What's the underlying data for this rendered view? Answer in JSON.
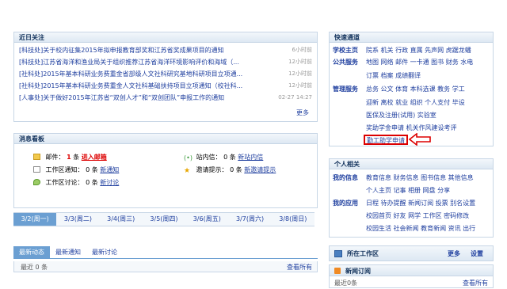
{
  "focus": {
    "title": "近日关注",
    "items": [
      {
        "text": "[科技处]关于校内征集2015年拟申报教育部奖和江苏省奖成果项目的通知",
        "time": "6小时前"
      },
      {
        "text": "[科技处]江苏省海洋和渔业局关于组织推荐江苏省海洋环境影响评价和海域（...",
        "time": "12小时前"
      },
      {
        "text": "[社科处]2015年基本科研业务费重金省部级人文社科研究基地科研项目立项通...",
        "time": "12小时前"
      },
      {
        "text": "[社科处]2015年基本科研业务费重金人文社科基础扶持项目立项通知（校社科...",
        "time": "12小时前"
      },
      {
        "text": "[人事处]关于做好2015年江苏省“双创人才”和“双创团队”申报工作的通知",
        "time": "02-27 14:27"
      }
    ],
    "more": "更多"
  },
  "messages": {
    "title": "消息看板",
    "mail_label": "邮件：",
    "mail_count": "1",
    "mail_unit": "条",
    "mail_link": "进入邮箱",
    "notify_label": "工作区通知：",
    "notify_count": "0",
    "notify_unit": "条",
    "notify_link": "新通知",
    "discuss_label": "工作区讨论：",
    "discuss_count": "0",
    "discuss_unit": "条",
    "discuss_link": "新讨论",
    "inbox_label": "站内信：",
    "inbox_count": "0",
    "inbox_unit": "条",
    "inbox_link": "新站内信",
    "invite_label": "邀请提示：",
    "invite_count": "0",
    "invite_unit": "条",
    "invite_link": "新邀请提示"
  },
  "days": [
    "3/2(周一)",
    "3/3(周二)",
    "3/4(周三)",
    "3/5(周四)",
    "3/6(周五)",
    "3/7(周六)",
    "3/8(周日)"
  ],
  "activity": {
    "tabs": [
      "最新动态",
      "最新通知",
      "最新讨论"
    ],
    "count": "最近 0 条",
    "view_all": "查看所有"
  },
  "quick": {
    "title": "快速通道",
    "rows": [
      {
        "cat": "学校主页",
        "links": "院系 机关 行政 直属 先声网 虎踞龙蟠"
      },
      {
        "cat": "公共服务",
        "links": "地图 网络 邮件 一卡通 图书 财务 水电"
      },
      {
        "cat": "",
        "links": "订票 档案 成绩翻译"
      },
      {
        "cat": "管理服务",
        "links": "总务 公文 体育 本科选课 教务 学工"
      },
      {
        "cat": "",
        "links": "迎新 离校 就业 组织 个人支付 毕设"
      },
      {
        "cat": "",
        "links": "医保及注册(试用) 实验室"
      },
      {
        "cat": "",
        "links": "奖助学金申请 机关作风建设考评"
      }
    ],
    "highlight": "勤工助学申请"
  },
  "personal": {
    "title": "个人相关",
    "rows": [
      {
        "cat": "我的信息",
        "links": "教育信息 财务信息 图书信息 其他信息"
      },
      {
        "cat": "",
        "links": "个人主页 记事 相册 网盘 分享"
      },
      {
        "cat": "我的应用",
        "links": "日程 待办提醒 新闻订阅 投票 别名设置"
      },
      {
        "cat": "",
        "links": "校园首页 好友 网学 工作区 密码修改"
      },
      {
        "cat": "",
        "links": "校园生活 社会新闻 教育新闻 资讯 出行"
      }
    ]
  },
  "workspace": {
    "title": "所在工作区",
    "more": "更多",
    "settings": "设置"
  },
  "feeds": {
    "title": "新闻订阅",
    "count": "最近0条",
    "view_all": "查看所有"
  },
  "colors": {
    "link": "#1f3f9f",
    "accent": "#6b9fd2",
    "alert": "#d00000"
  }
}
